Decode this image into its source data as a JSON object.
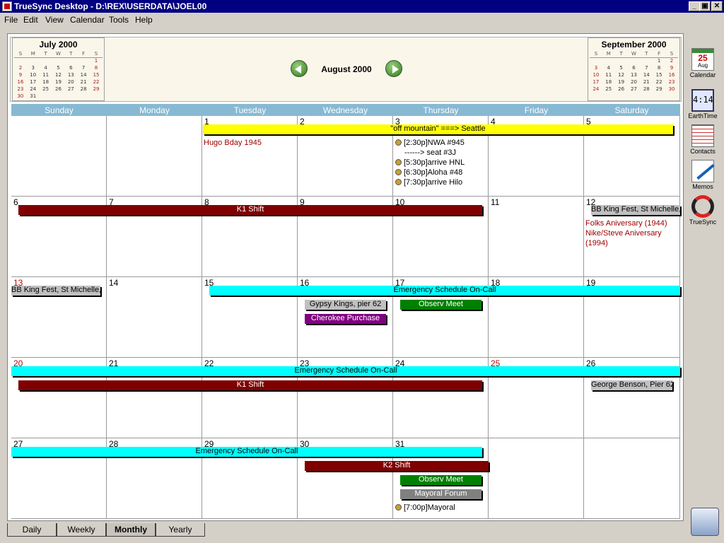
{
  "window": {
    "title": "TrueSync Desktop - D:\\REX\\USERDATA\\JOEL00",
    "min": "_",
    "max": "▣",
    "close": "✕"
  },
  "menu": [
    "File",
    "Edit",
    "View",
    "Calendar",
    "Tools",
    "Help"
  ],
  "header": {
    "current_month": "August 2000",
    "prev_mini": {
      "title": "July 2000",
      "dow": [
        "S",
        "M",
        "T",
        "W",
        "T",
        "F",
        "S"
      ],
      "weeks": [
        [
          "",
          "",
          "",
          "",
          "",
          "",
          "1"
        ],
        [
          "2",
          "3",
          "4",
          "5",
          "6",
          "7",
          "8"
        ],
        [
          "9",
          "10",
          "11",
          "12",
          "13",
          "14",
          "15"
        ],
        [
          "16",
          "17",
          "18",
          "19",
          "20",
          "21",
          "22"
        ],
        [
          "23",
          "24",
          "25",
          "26",
          "27",
          "28",
          "29"
        ],
        [
          "30",
          "31",
          "",
          "",
          "",
          "",
          ""
        ]
      ]
    },
    "next_mini": {
      "title": "September 2000",
      "dow": [
        "S",
        "M",
        "T",
        "W",
        "T",
        "F",
        "S"
      ],
      "weeks": [
        [
          "",
          "",
          "",
          "",
          "",
          "1",
          "2"
        ],
        [
          "3",
          "4",
          "5",
          "6",
          "7",
          "8",
          "9"
        ],
        [
          "10",
          "11",
          "12",
          "13",
          "14",
          "15",
          "16"
        ],
        [
          "17",
          "18",
          "19",
          "20",
          "21",
          "22",
          "23"
        ],
        [
          "24",
          "25",
          "26",
          "27",
          "28",
          "29",
          "30"
        ]
      ]
    }
  },
  "weekdays": [
    "Sunday",
    "Monday",
    "Tuesday",
    "Wednesday",
    "Thursday",
    "Friday",
    "Saturday"
  ],
  "weeks": [
    [
      "",
      "",
      "1",
      "2",
      "3",
      "4",
      "5"
    ],
    [
      "6",
      "7",
      "8",
      "9",
      "10",
      "11",
      "12"
    ],
    [
      "13",
      "14",
      "15",
      "16",
      "17",
      "18",
      "19"
    ],
    [
      "20",
      "21",
      "22",
      "23",
      "24",
      "25",
      "26"
    ],
    [
      "27",
      "28",
      "29",
      "30",
      "31",
      "",
      ""
    ]
  ],
  "red_days": [
    "13",
    "20",
    "25"
  ],
  "events": {
    "w1_off_mountain": "\"off mountain\" ===> Seattle",
    "hugo_bday": "Hugo Bday 1945",
    "nwa": "[2:30p]NWA #945",
    "seat": "------> seat #3J",
    "arrive_hnl": "[5:30p]arrive HNL",
    "aloha": "[6:30p]Aloha #48",
    "arrive_hilo": "[7:30p]arrive Hilo",
    "k1_shift_w2": "K1 Shift",
    "bb_king_w2": "BB King Fest, St Michelle, Woodinville",
    "folks_anniv": "Folks Aniversary (1944)",
    "nike_anniv": "Nike/Steve Aniversary",
    "nike_year": "(1994)",
    "bb_king_w3": "BB King Fest, St Michelle,",
    "emergency_w3": "Emergency Schedule On-Call",
    "gypsy_kings": "Gypsy Kings, pier 62",
    "cherokee": "Cherokee Purchase",
    "observ_w3": "Observ Meet",
    "emergency_w4": "Emergency Schedule On-Call",
    "k1_shift_w4": "K1 Shift",
    "george_benson": "George Benson, Pier 62",
    "emergency_w5": "Emergency Schedule On-Call",
    "k2_shift": "K2 Shift",
    "observ_w5": "Observ Meet",
    "mayoral_forum": "Mayoral Forum",
    "mayoral_time": "[7:00p]Mayoral"
  },
  "apps": [
    {
      "label": "Calendar",
      "icon": "calendar-icon",
      "icon_day": "25",
      "icon_month": "Aug"
    },
    {
      "label": "EarthTime",
      "icon": "clock-icon",
      "time": "4:14"
    },
    {
      "label": "Contacts",
      "icon": "contacts-icon"
    },
    {
      "label": "Memos",
      "icon": "memo-icon"
    },
    {
      "label": "TrueSync",
      "icon": "sync-icon"
    }
  ],
  "tabs": [
    "Daily",
    "Weekly",
    "Monthly",
    "Yearly"
  ],
  "active_tab": "Monthly",
  "colors": {
    "yellow": "#ffff00",
    "maroon": "#800000",
    "cyan": "#00ffff",
    "green": "#008000",
    "purple": "#800080",
    "gray": "#c0c0c0",
    "darkgray": "#808080",
    "header_blue": "#87b9d3"
  }
}
